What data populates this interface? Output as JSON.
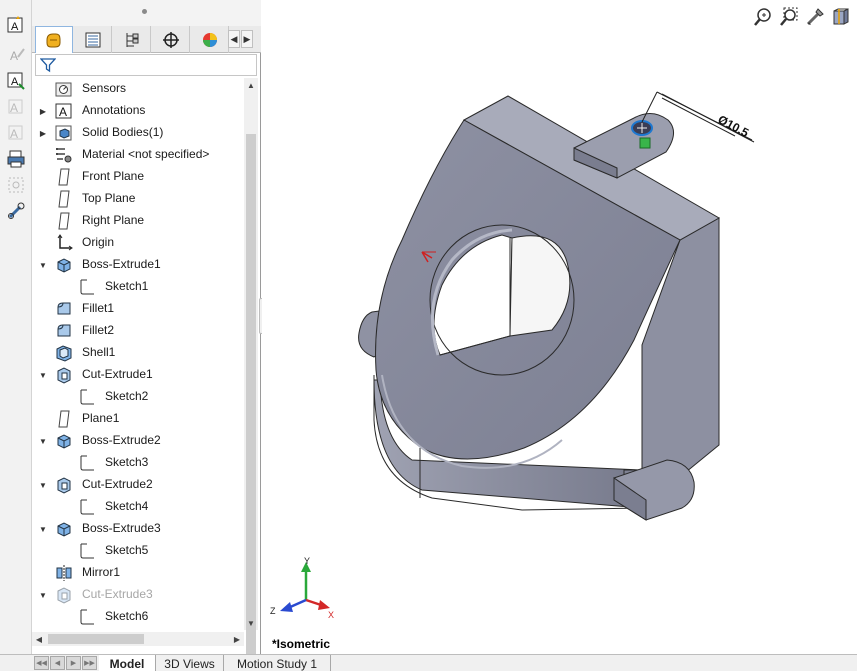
{
  "feature_tree": {
    "items": [
      {
        "label": "Sensors",
        "icon": "sensors-icon",
        "indent": 0,
        "expander": ""
      },
      {
        "label": "Annotations",
        "icon": "annotations-icon",
        "indent": 0,
        "expander": "right"
      },
      {
        "label": "Solid Bodies(1)",
        "icon": "solid-bodies-icon",
        "indent": 0,
        "expander": "right"
      },
      {
        "label": "Material <not specified>",
        "icon": "material-icon",
        "indent": 0,
        "expander": ""
      },
      {
        "label": "Front Plane",
        "icon": "plane-icon",
        "indent": 0,
        "expander": ""
      },
      {
        "label": "Top Plane",
        "icon": "plane-icon",
        "indent": 0,
        "expander": ""
      },
      {
        "label": "Right Plane",
        "icon": "plane-icon",
        "indent": 0,
        "expander": ""
      },
      {
        "label": "Origin",
        "icon": "origin-icon",
        "indent": 0,
        "expander": ""
      },
      {
        "label": "Boss-Extrude1",
        "icon": "boss-extrude-icon",
        "indent": 0,
        "expander": "down"
      },
      {
        "label": "Sketch1",
        "icon": "sketch-icon",
        "indent": 1,
        "expander": ""
      },
      {
        "label": "Fillet1",
        "icon": "fillet-icon",
        "indent": 0,
        "expander": ""
      },
      {
        "label": "Fillet2",
        "icon": "fillet-icon",
        "indent": 0,
        "expander": ""
      },
      {
        "label": "Shell1",
        "icon": "shell-icon",
        "indent": 0,
        "expander": ""
      },
      {
        "label": "Cut-Extrude1",
        "icon": "cut-extrude-icon",
        "indent": 0,
        "expander": "down"
      },
      {
        "label": "Sketch2",
        "icon": "sketch-icon",
        "indent": 1,
        "expander": ""
      },
      {
        "label": "Plane1",
        "icon": "plane-icon",
        "indent": 0,
        "expander": ""
      },
      {
        "label": "Boss-Extrude2",
        "icon": "boss-extrude-icon",
        "indent": 0,
        "expander": "down"
      },
      {
        "label": "Sketch3",
        "icon": "sketch-icon",
        "indent": 1,
        "expander": ""
      },
      {
        "label": "Cut-Extrude2",
        "icon": "cut-extrude-icon",
        "indent": 0,
        "expander": "down"
      },
      {
        "label": "Sketch4",
        "icon": "sketch-icon",
        "indent": 1,
        "expander": ""
      },
      {
        "label": "Boss-Extrude3",
        "icon": "boss-extrude-icon",
        "indent": 0,
        "expander": "down"
      },
      {
        "label": "Sketch5",
        "icon": "sketch-icon",
        "indent": 1,
        "expander": ""
      },
      {
        "label": "Mirror1",
        "icon": "mirror-icon",
        "indent": 0,
        "expander": ""
      },
      {
        "label": "Cut-Extrude3",
        "icon": "cut-extrude-icon",
        "indent": 0,
        "expander": "down",
        "suppressed": true
      },
      {
        "label": "Sketch6",
        "icon": "sketch-icon",
        "indent": 1,
        "expander": ""
      }
    ]
  },
  "tabs": [
    "FeatureManager Design Tree",
    "PropertyManager",
    "ConfigurationManager",
    "DimXpertManager",
    "DisplayManager"
  ],
  "bottom_tabs": [
    {
      "label": "Model",
      "active": true
    },
    {
      "label": "3D Views",
      "active": false
    },
    {
      "label": "Motion Study 1",
      "active": false
    }
  ],
  "viewport": {
    "view_label": "*Isometric",
    "dimension_text": "Ø10.5",
    "heads_up_icons": [
      "zoom-to-fit-icon",
      "zoom-to-area-icon",
      "previous-view-icon",
      "section-view-icon"
    ],
    "triad_axes": [
      "Y",
      "Z",
      "X"
    ]
  },
  "colors": {
    "model_face": "#8a8d9e",
    "model_dark": "#6f7284",
    "model_light": "#a9acbb",
    "selection_blue": "#1e78d0",
    "accent_orange": "#e8a100"
  }
}
